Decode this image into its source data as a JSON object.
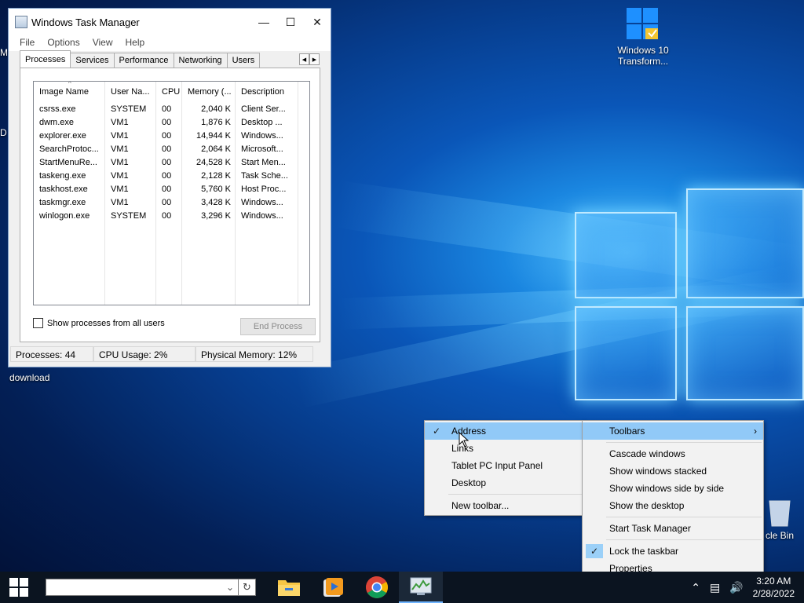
{
  "desktop": {
    "icons": [
      {
        "label": "Windows 10 Transform...",
        "label_line1": "Windows 10",
        "label_line2": "Transform..."
      },
      {
        "label": "download"
      },
      {
        "label": "cle Bin"
      }
    ],
    "edge_fragments": [
      "M",
      "D"
    ]
  },
  "task_manager": {
    "title": "Windows Task Manager",
    "menu": [
      "File",
      "Options",
      "View",
      "Help"
    ],
    "tabs": [
      "Processes",
      "Services",
      "Performance",
      "Networking",
      "Users"
    ],
    "active_tab": "Processes",
    "columns": [
      "Image Name",
      "User Na...",
      "CPU",
      "Memory (...",
      "Description"
    ],
    "rows": [
      [
        "csrss.exe",
        "SYSTEM",
        "00",
        "2,040 K",
        "Client Ser..."
      ],
      [
        "dwm.exe",
        "VM1",
        "00",
        "1,876 K",
        "Desktop ..."
      ],
      [
        "explorer.exe",
        "VM1",
        "00",
        "14,944 K",
        "Windows..."
      ],
      [
        "SearchProtoc...",
        "VM1",
        "00",
        "2,064 K",
        "Microsoft..."
      ],
      [
        "StartMenuRe...",
        "VM1",
        "00",
        "24,528 K",
        "Start Men..."
      ],
      [
        "taskeng.exe",
        "VM1",
        "00",
        "2,128 K",
        "Task Sche..."
      ],
      [
        "taskhost.exe",
        "VM1",
        "00",
        "5,760 K",
        "Host Proc..."
      ],
      [
        "taskmgr.exe",
        "VM1",
        "00",
        "3,428 K",
        "Windows..."
      ],
      [
        "winlogon.exe",
        "SYSTEM",
        "00",
        "3,296 K",
        "Windows..."
      ]
    ],
    "show_all_label": "Show processes from all users",
    "end_process_label": "End Process",
    "status": {
      "processes": "Processes: 44",
      "cpu": "CPU Usage: 2%",
      "memory": "Physical Memory: 12%"
    }
  },
  "toolbars_submenu": {
    "items": [
      {
        "label": "Address",
        "checked": true,
        "highlighted": true
      },
      {
        "label": "Links",
        "checked": false
      },
      {
        "label": "Tablet PC Input Panel",
        "checked": false
      },
      {
        "label": "Desktop",
        "checked": false
      },
      {
        "label": "New toolbar...",
        "checked": false
      }
    ]
  },
  "taskbar_menu": {
    "toolbars": "Toolbars",
    "cascade": "Cascade windows",
    "stacked": "Show windows stacked",
    "side_by_side": "Show windows side by side",
    "show_desktop": "Show the desktop",
    "start_task_manager": "Start Task Manager",
    "lock_taskbar": "Lock the taskbar",
    "properties": "Properties"
  },
  "taskbar": {
    "address_value": "",
    "clock_time": "3:20 AM",
    "clock_date": "2/28/2022"
  },
  "colors": {
    "accent": "#0078d7",
    "menu_highlight": "#91c9f7",
    "taskbar": "#0b1420"
  }
}
